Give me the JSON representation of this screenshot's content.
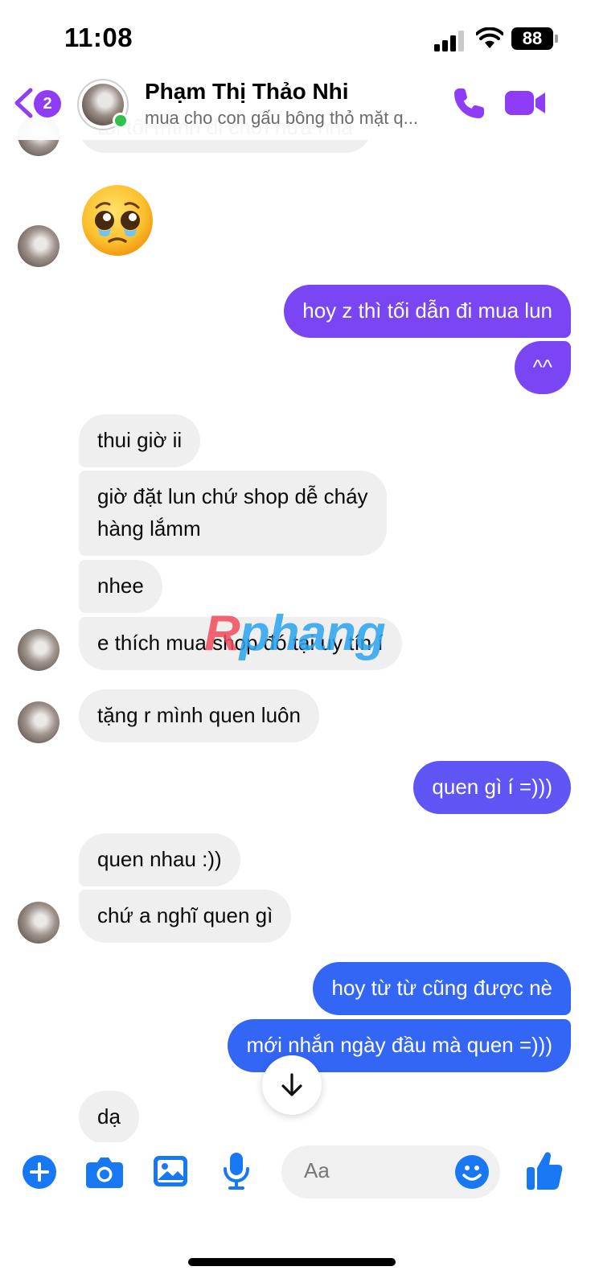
{
  "status_bar": {
    "time": "11:08",
    "battery": "88"
  },
  "header": {
    "back_badge": "2",
    "contact_name": "Phạm Thị Thảo Nhi",
    "subtitle": "mua cho con gấu bông thỏ mặt q...",
    "icons": [
      "back-icon",
      "phone-icon",
      "video-camera-icon"
    ]
  },
  "messages": {
    "partial_top": "rùi tối mình đi chơi nữa nha",
    "emoji": "pleading-face",
    "m1": "hoy z thì tối dẫn đi mua lun",
    "m2": "^^",
    "m3": "thui giờ ii",
    "m4_line1": "giờ đặt lun chứ shop dễ cháy",
    "m4_line2": "hàng lắmm",
    "m5": "nhee",
    "m6": "e thích mua shop đó tại uy tín í",
    "m7": "tặng r mình quen luôn",
    "m8": "quen gì í =)))",
    "m9": "quen nhau :))",
    "m10": "chứ a nghĩ quen gì",
    "m11": "hoy từ từ cũng được nè",
    "m12": "mới nhắn ngày đầu mà quen =)))",
    "m13": "dạ"
  },
  "watermark": {
    "part1": "R",
    "part2": "phang"
  },
  "composer": {
    "placeholder": "Aa",
    "icons": [
      "plus-icon",
      "camera-icon",
      "gallery-icon",
      "microphone-icon",
      "emoji-icon",
      "thumbs-up-icon"
    ]
  },
  "colors": {
    "accent": "#8f3cf7",
    "out_purple": "#7a45f2",
    "out_indigo": "#5e55f4",
    "out_blue": "#3466f6",
    "incoming": "#efefef",
    "composer_blue": "#1877f2"
  }
}
